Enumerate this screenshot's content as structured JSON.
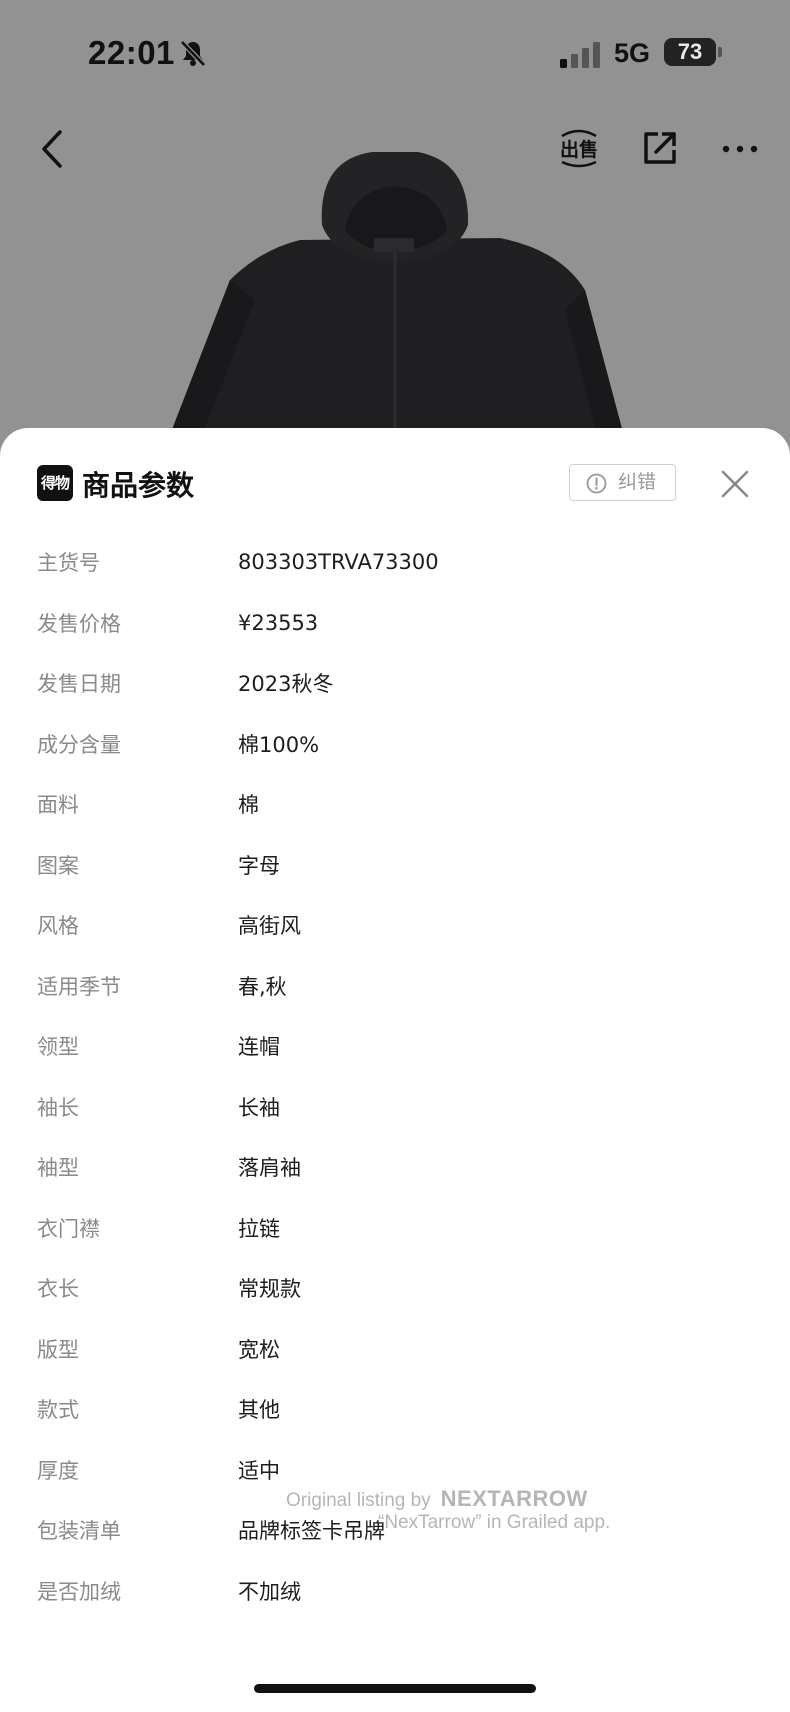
{
  "status_bar": {
    "time": "22:01",
    "network": "5G",
    "battery": "73",
    "icons": [
      "bell-off-icon",
      "signal-icon"
    ]
  },
  "nav": {
    "sell_label": "出售",
    "icons": [
      "back-icon",
      "sell-icon",
      "share-icon",
      "more-icon"
    ]
  },
  "sheet": {
    "logo_text": "得物",
    "title": "商品参数",
    "report_label": "纠错",
    "params": [
      {
        "label": "主货号",
        "value": "803303TRVA73300"
      },
      {
        "label": "发售价格",
        "value": "¥23553"
      },
      {
        "label": "发售日期",
        "value": "2023秋冬"
      },
      {
        "label": "成分含量",
        "value": "棉100%"
      },
      {
        "label": "面料",
        "value": "棉"
      },
      {
        "label": "图案",
        "value": "字母"
      },
      {
        "label": "风格",
        "value": "高街风"
      },
      {
        "label": "适用季节",
        "value": "春,秋"
      },
      {
        "label": "领型",
        "value": "连帽"
      },
      {
        "label": "袖长",
        "value": "长袖"
      },
      {
        "label": "袖型",
        "value": "落肩袖"
      },
      {
        "label": "衣门襟",
        "value": "拉链"
      },
      {
        "label": "衣长",
        "value": "常规款"
      },
      {
        "label": "版型",
        "value": "宽松"
      },
      {
        "label": "款式",
        "value": "其他"
      },
      {
        "label": "厚度",
        "value": "适中"
      },
      {
        "label": "包装清单",
        "value": "品牌标签卡吊牌"
      },
      {
        "label": "是否加绒",
        "value": "不加绒"
      }
    ]
  },
  "watermark": {
    "line1": "Original listing by",
    "brand": "NEXTARROW",
    "line2": "“NexTarrow” in Grailed app."
  },
  "colors": {
    "backdrop": "#929292",
    "sheet": "#ffffff",
    "label": "#8a8a8a",
    "value": "#1d1d1d"
  }
}
